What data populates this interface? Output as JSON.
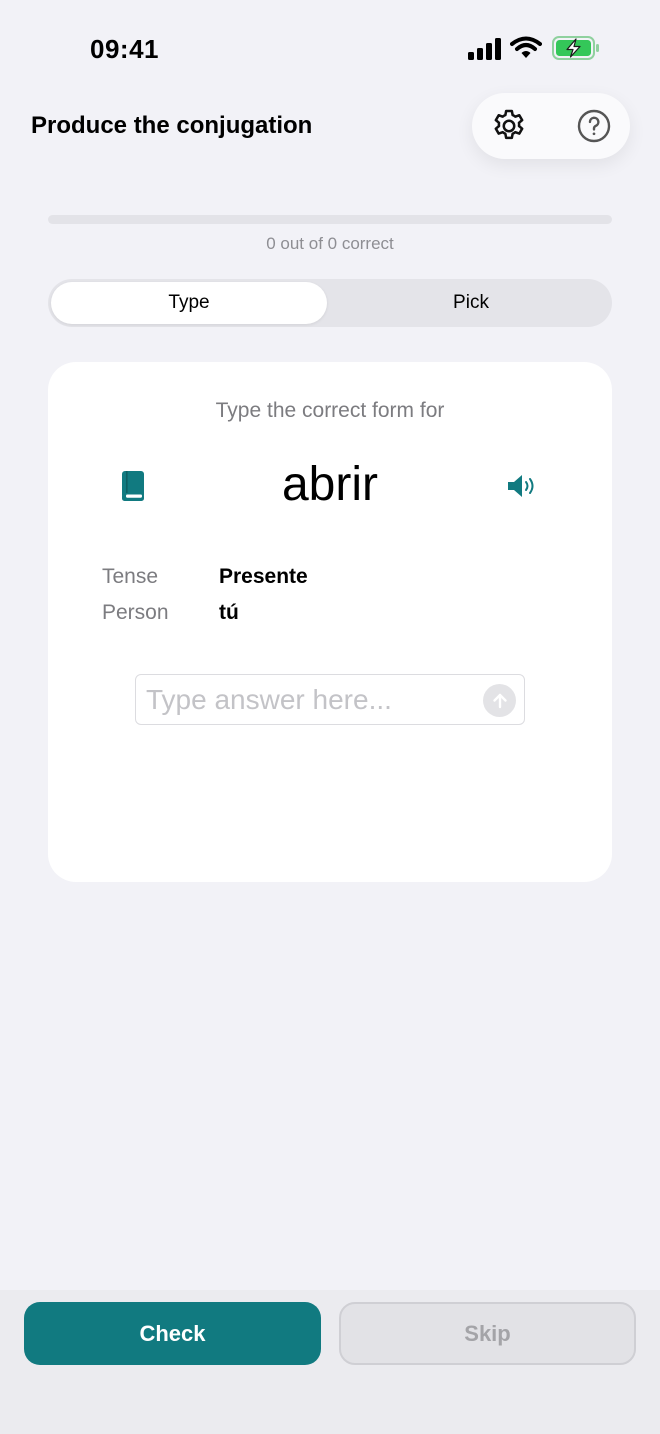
{
  "status_bar": {
    "time": "09:41",
    "icons": [
      "cellular-signal-icon",
      "wifi-icon",
      "battery-charging-icon"
    ]
  },
  "header": {
    "title": "Produce the conjugation",
    "actions": [
      "gear-icon",
      "help-icon"
    ]
  },
  "progress": {
    "text": "0 out of 0 correct",
    "correct": 0,
    "total": 0,
    "fraction": 0
  },
  "mode": {
    "options": [
      "Type",
      "Pick"
    ],
    "selected": "Type"
  },
  "card": {
    "prompt": "Type the correct form for",
    "verb": "abrir",
    "icons": [
      "book-icon",
      "speaker-icon"
    ],
    "rows": [
      {
        "label": "Tense",
        "value": "Presente"
      },
      {
        "label": "Person",
        "value": "tú"
      }
    ],
    "answer": {
      "value": "",
      "placeholder": "Type answer here..."
    }
  },
  "footer": {
    "check_label": "Check",
    "skip_label": "Skip"
  },
  "colors": {
    "accent": "#117a80",
    "background": "#f2f2f7",
    "battery": "#34c759"
  }
}
